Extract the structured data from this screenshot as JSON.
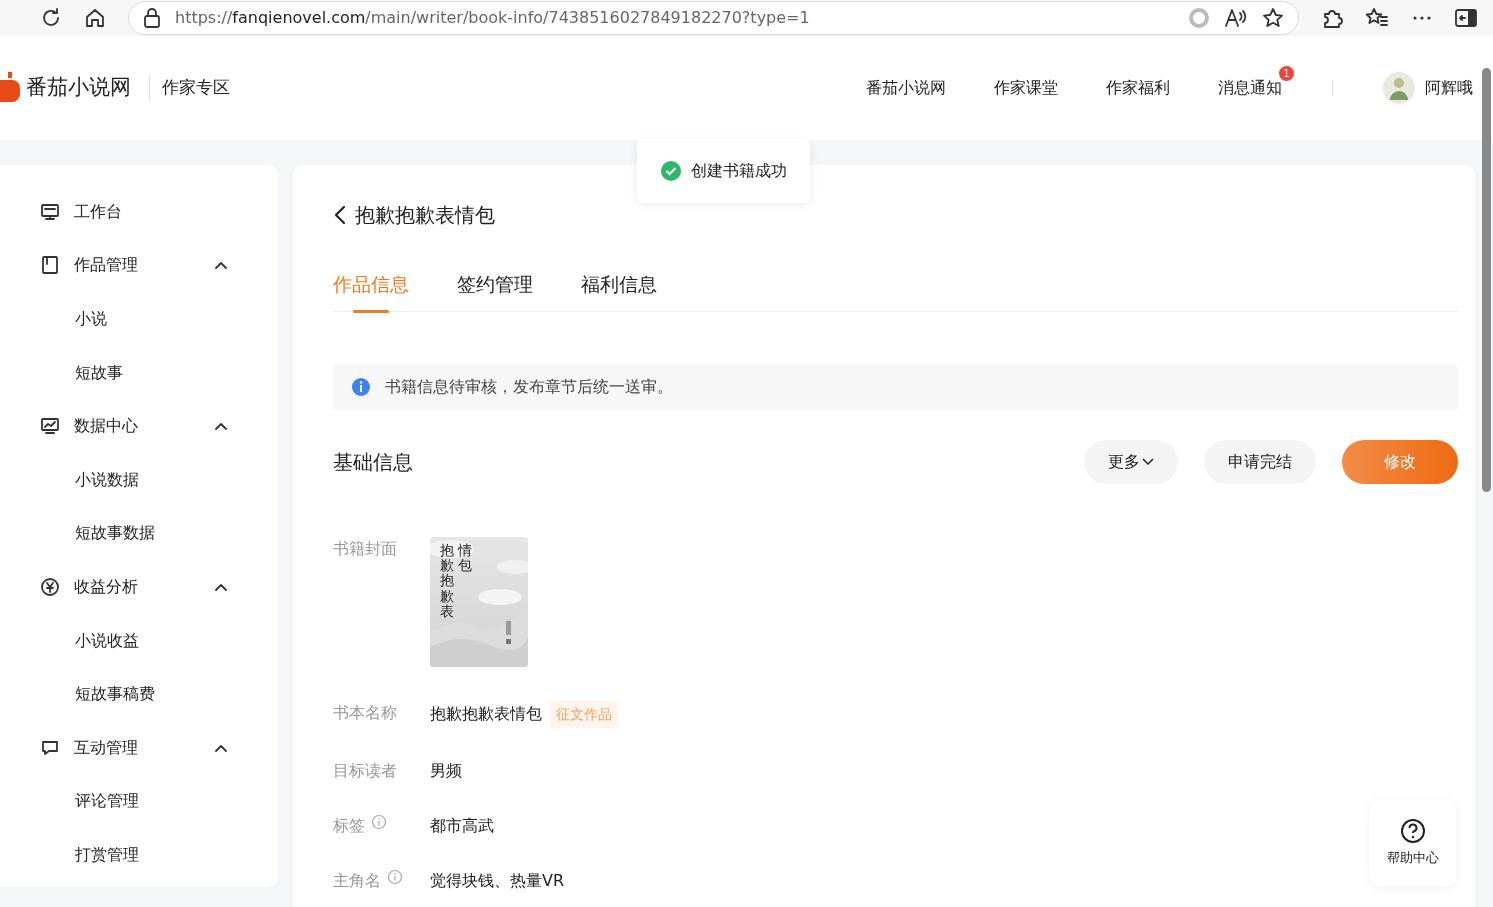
{
  "browser": {
    "url_scheme": "https://",
    "url_host": "fanqienovel.com",
    "url_path": "/main/writer/book-info/7438516027849182270?type=1"
  },
  "header": {
    "logo_text": "番茄小说网",
    "section": "作家专区",
    "nav": [
      {
        "label": "番茄小说网"
      },
      {
        "label": "作家课堂"
      },
      {
        "label": "作家福利"
      },
      {
        "label": "消息通知",
        "badge": "1"
      }
    ],
    "user": "阿辉哦"
  },
  "toast": {
    "text": "创建书籍成功"
  },
  "sidebar": {
    "items": [
      {
        "label": "工作台"
      },
      {
        "label": "作品管理",
        "expanded": true,
        "children": [
          {
            "label": "小说"
          },
          {
            "label": "短故事"
          }
        ]
      },
      {
        "label": "数据中心",
        "expanded": true,
        "children": [
          {
            "label": "小说数据"
          },
          {
            "label": "短故事数据"
          }
        ]
      },
      {
        "label": "收益分析",
        "expanded": true,
        "children": [
          {
            "label": "小说收益"
          },
          {
            "label": "短故事稿费"
          }
        ]
      },
      {
        "label": "互动管理",
        "expanded": true,
        "children": [
          {
            "label": "评论管理"
          },
          {
            "label": "打赏管理"
          }
        ]
      }
    ]
  },
  "page": {
    "title": "抱歉抱歉表情包",
    "tabs": [
      {
        "label": "作品信息",
        "selected": true
      },
      {
        "label": "签约管理",
        "selected": false
      },
      {
        "label": "福利信息",
        "selected": false
      }
    ],
    "notice": "书籍信息待审核，发布章节后统一送审。",
    "section_title": "基础信息",
    "buttons": [
      {
        "label": "更多",
        "kind": "dropdown"
      },
      {
        "label": "申请完结",
        "kind": "plain"
      },
      {
        "label": "修改",
        "kind": "primary"
      }
    ],
    "fields": [
      {
        "label": "书籍封面",
        "kind": "cover",
        "info": false,
        "cover_columns": [
          "抱歉抱歉表",
          "情包"
        ]
      },
      {
        "label": "书本名称",
        "kind": "text",
        "info": false,
        "value": "抱歉抱歉表情包",
        "tag": "征文作品"
      },
      {
        "label": "目标读者",
        "kind": "text",
        "info": false,
        "value": "男频"
      },
      {
        "label": "标签",
        "kind": "text",
        "info": true,
        "value": "都市高武"
      },
      {
        "label": "主角名",
        "kind": "text",
        "info": true,
        "value": "觉得块钱、热量VR"
      }
    ]
  },
  "help": {
    "label": "帮助中心"
  }
}
